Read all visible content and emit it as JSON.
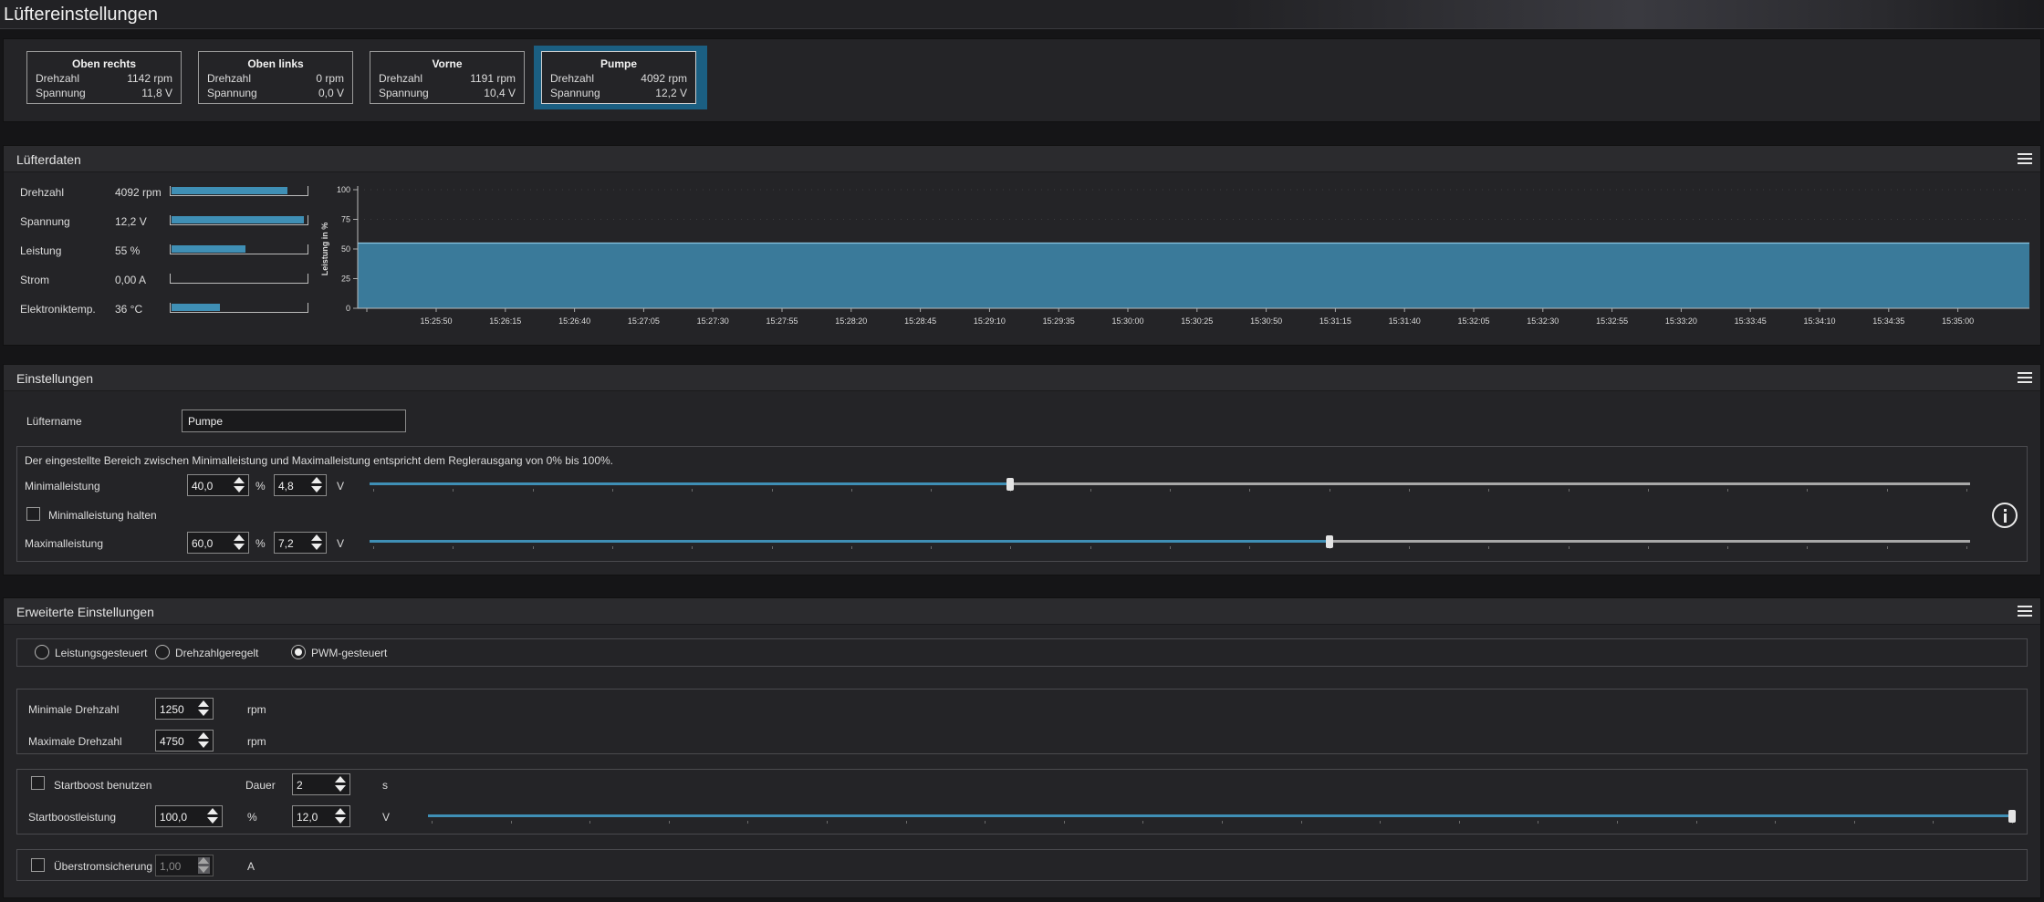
{
  "window": {
    "title": "Lüftereinstellungen"
  },
  "fans": [
    {
      "name": "Oben rechts",
      "rpm_label": "Drehzahl",
      "rpm": "1142 rpm",
      "volt_label": "Spannung",
      "volt": "11,8 V"
    },
    {
      "name": "Oben links",
      "rpm_label": "Drehzahl",
      "rpm": "0 rpm",
      "volt_label": "Spannung",
      "volt": "0,0 V"
    },
    {
      "name": "Vorne",
      "rpm_label": "Drehzahl",
      "rpm": "1191 rpm",
      "volt_label": "Spannung",
      "volt": "10,4 V"
    },
    {
      "name": "Pumpe",
      "rpm_label": "Drehzahl",
      "rpm": "4092 rpm",
      "volt_label": "Spannung",
      "volt": "12,2 V",
      "selected": true
    }
  ],
  "fan_data": {
    "title": "Lüfterdaten",
    "rows": [
      {
        "label": "Drehzahl",
        "value": "4092 rpm",
        "fraction": 0.86
      },
      {
        "label": "Spannung",
        "value": "12,2 V",
        "fraction": 0.98
      },
      {
        "label": "Leistung",
        "value": "55 %",
        "fraction": 0.55
      },
      {
        "label": "Strom",
        "value": "0,00 A",
        "fraction": 0.0
      },
      {
        "label": "Elektroniktemp.",
        "value": "36 °C",
        "fraction": 0.36
      }
    ]
  },
  "chart_data": {
    "type": "area",
    "ylabel": "Leistung in %",
    "ylim": [
      0,
      100
    ],
    "yticks": [
      "0",
      "25",
      "50",
      "75",
      "100"
    ],
    "x": [
      "15:25:50",
      "15:26:15",
      "15:26:40",
      "15:27:05",
      "15:27:30",
      "15:27:55",
      "15:28:20",
      "15:28:45",
      "15:29:10",
      "15:29:35",
      "15:30:00",
      "15:30:25",
      "15:30:50",
      "15:31:15",
      "15:31:40",
      "15:32:05",
      "15:32:30",
      "15:32:55",
      "15:33:20",
      "15:33:45",
      "15:34:10",
      "15:34:35",
      "15:35:00"
    ],
    "series": [
      {
        "values": [
          55,
          55,
          55,
          55,
          55,
          55,
          55,
          55,
          55,
          55,
          55,
          55,
          55,
          55,
          55,
          55,
          55,
          55,
          55,
          55,
          55,
          55,
          55
        ]
      }
    ],
    "color": "#3a7a9a",
    "grid": true
  },
  "settings": {
    "title": "Einstellungen",
    "fan_name_label": "Lüftername",
    "fan_name_value": "Pumpe",
    "range_note": "Der eingestellte Bereich zwischen Minimalleistung und Maximalleistung entspricht dem Reglerausgang von 0% bis 100%.",
    "min_label": "Minimalleistung",
    "min_percent": "40,0",
    "min_volt": "4,8",
    "min_fraction": 0.4,
    "hold_min_label": "Minimalleistung halten",
    "max_label": "Maximalleistung",
    "max_percent": "60,0",
    "max_volt": "7,2",
    "max_fraction": 0.6,
    "unit_percent": "%",
    "unit_volt": "V"
  },
  "advanced": {
    "title": "Erweiterte Einstellungen",
    "modes": [
      {
        "label": "Leistungsgesteuert",
        "checked": false
      },
      {
        "label": "Drehzahlgeregelt",
        "checked": false
      },
      {
        "label": "PWM-gesteuert",
        "checked": true
      }
    ],
    "min_rpm_label": "Minimale Drehzahl",
    "min_rpm": "1250",
    "max_rpm_label": "Maximale Drehzahl",
    "max_rpm": "4750",
    "unit_rpm": "rpm",
    "startboost_label": "Startboost benutzen",
    "duration_label": "Dauer",
    "duration": "2",
    "unit_s": "s",
    "startboost_power_label": "Startboostleistung",
    "startboost_percent": "100,0",
    "startboost_volt": "12,0",
    "startboost_fraction": 1.0,
    "unit_percent": "%",
    "unit_volt": "V",
    "overcurrent_label": "Überstromsicherung",
    "overcurrent": "1,00",
    "unit_a": "A"
  }
}
